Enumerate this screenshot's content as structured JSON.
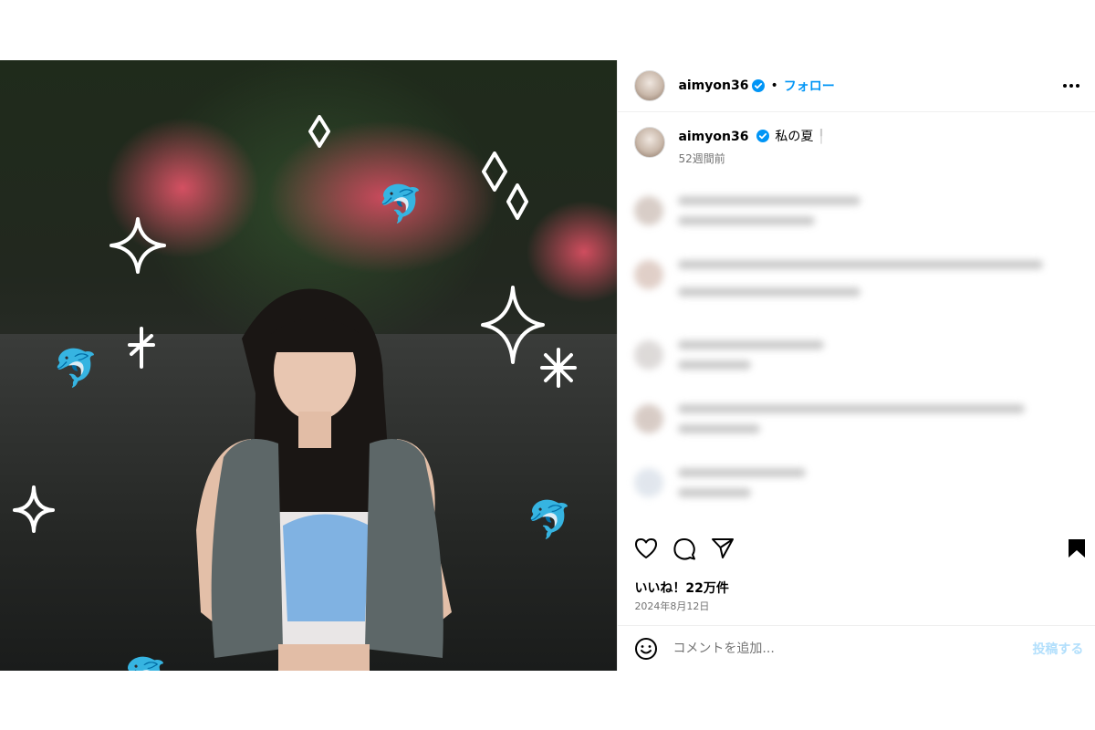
{
  "header": {
    "username": "aimyon36",
    "separator": "•",
    "follow_label": "フォロー",
    "more_icon": "more-horizontal-icon"
  },
  "caption": {
    "username": "aimyon36",
    "text": "私の夏",
    "time": "52週間前"
  },
  "actions": {
    "icons": [
      "heart-icon",
      "comment-icon",
      "share-icon",
      "bookmark-icon"
    ]
  },
  "likes_text": "いいね！22万件",
  "date_text": "2024年8月12日",
  "comment_input": {
    "placeholder": "コメントを追加...",
    "post_label": "投稿する"
  },
  "colors": {
    "accent": "#0095f6",
    "post_disabled": "#b2dffc",
    "muted": "#737373"
  },
  "photo": {
    "stickers": [
      "sparkle-icon",
      "dolphin-emoji"
    ]
  }
}
